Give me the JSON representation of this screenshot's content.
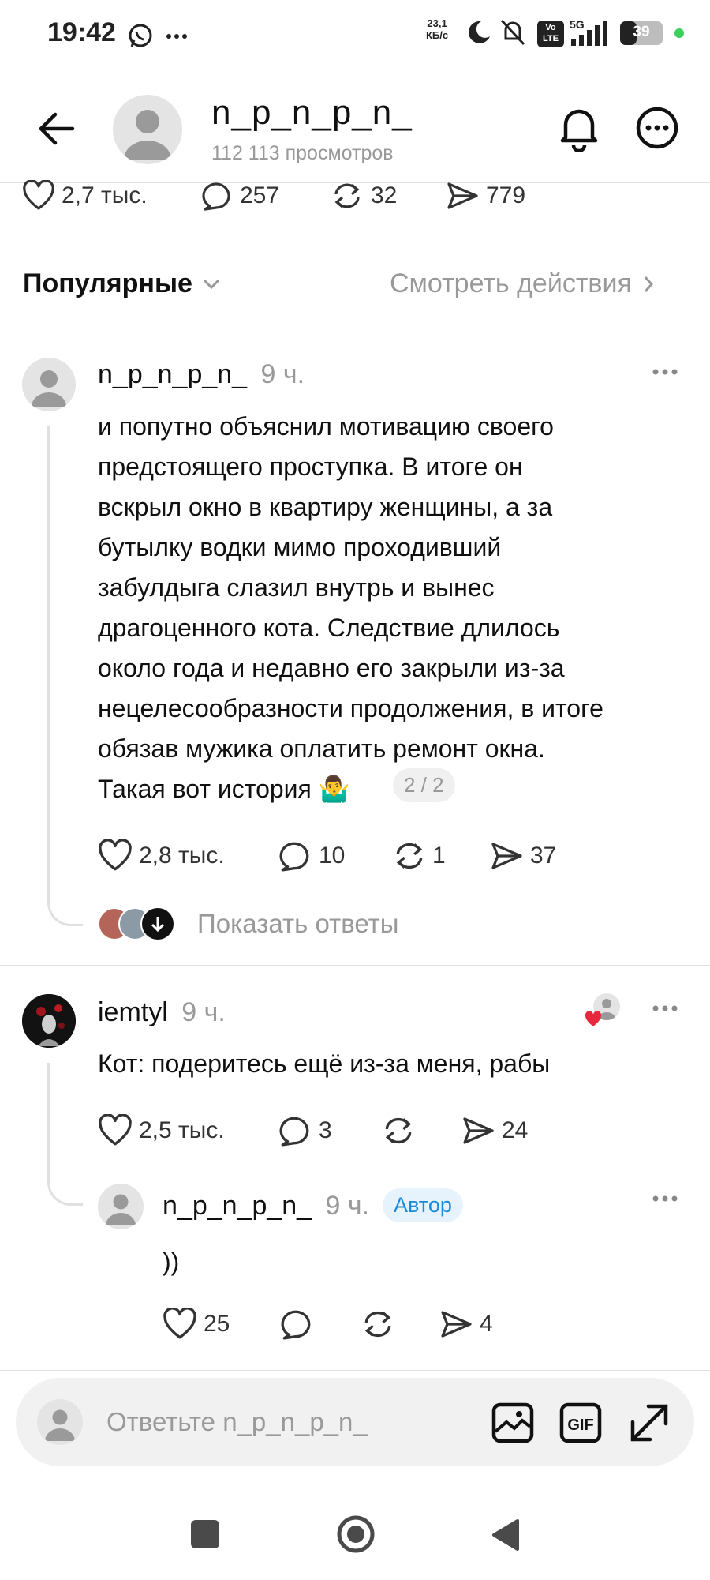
{
  "status_bar": {
    "time": "19:42",
    "rate_value": "23,1",
    "rate_unit": "КБ/с",
    "network": "5G",
    "volte": "Vo LTE",
    "battery": "39"
  },
  "header": {
    "username": "n_p_n_p_n_",
    "views": "112 113 просмотров"
  },
  "post_stats": {
    "likes": "2,7 тыс.",
    "comments": "257",
    "reposts": "32",
    "shares": "779"
  },
  "filter": {
    "sort_label": "Популярные",
    "actions_label": "Смотреть действия"
  },
  "comments": [
    {
      "username": "n_p_n_p_n_",
      "time": "9 ч.",
      "text_lines": [
        "и попутно объяснил мотивацию своего",
        "предстоящего проступка. В итоге он",
        "вскрыл окно в квартиру женщины, а за",
        "бутылку водки мимо проходивший",
        "забулдыга слазил внутрь и вынес",
        "драгоценного кота. Следствие длилось",
        "около года и недавно его закрыли из-за",
        "нецелесообразности продолжения, в итоге",
        "обязав мужика оплатить ремонт окна.",
        "Такая вот история 🤷‍♂️"
      ],
      "page_badge": "2 / 2",
      "likes": "2,8 тыс.",
      "comments": "10",
      "reposts": "1",
      "shares": "37",
      "show_replies": "Показать ответы"
    },
    {
      "username": "iemtyl",
      "time": "9 ч.",
      "text": "Кот: подеритесь ещё из-за меня, рабы",
      "likes": "2,5 тыс.",
      "comments": "3",
      "reposts": "",
      "shares": "24"
    },
    {
      "username": "n_p_n_p_n_",
      "time": "9 ч.",
      "badge": "Автор",
      "text": "))",
      "likes": "25",
      "comments": "",
      "reposts": "",
      "shares": "4"
    }
  ],
  "reply_bar": {
    "placeholder": "Ответьте n_p_n_p_n_"
  },
  "colors": {
    "accent_blue": "#1d8ad8",
    "badge_bg": "#e6f3fd",
    "heart_red": "#e8283c"
  }
}
